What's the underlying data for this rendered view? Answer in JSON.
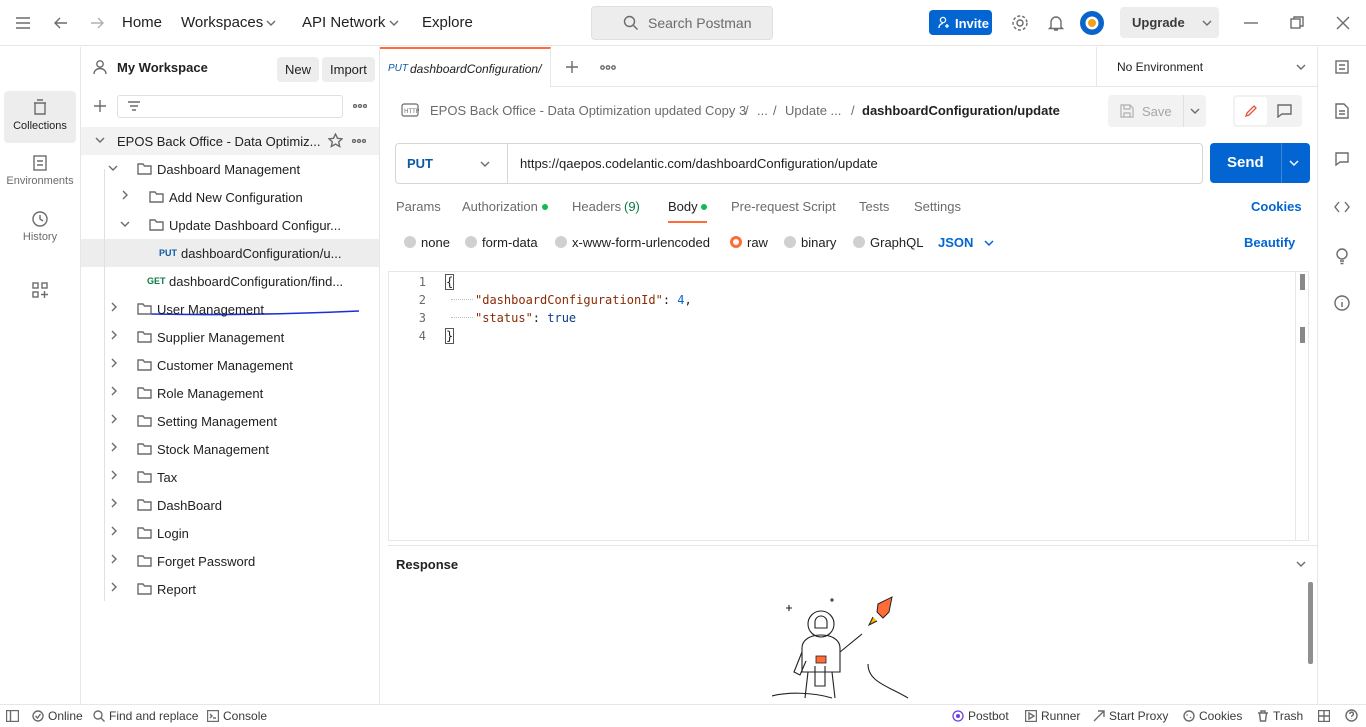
{
  "topbar": {
    "home": "Home",
    "workspaces": "Workspaces",
    "api_network": "API Network",
    "explore": "Explore",
    "search_placeholder": "Search Postman",
    "invite": "Invite",
    "upgrade": "Upgrade"
  },
  "rail": {
    "items": [
      {
        "label": "Collections",
        "icon": "collections-icon"
      },
      {
        "label": "Environments",
        "icon": "environments-icon"
      },
      {
        "label": "History",
        "icon": "history-icon"
      }
    ]
  },
  "sidebar": {
    "workspace": "My Workspace",
    "new_label": "New",
    "import_label": "Import",
    "collection": "EPOS Back Office - Data Optimiz...",
    "folders_top": {
      "dashboard_management": "Dashboard Management",
      "add_new_configuration": "Add New Configuration",
      "update_dashboard": "Update Dashboard Configur...",
      "req_put": {
        "method": "PUT",
        "name": "dashboardConfiguration/u..."
      },
      "req_get": {
        "method": "GET",
        "name": "dashboardConfiguration/find..."
      }
    },
    "folders": [
      "User Management",
      "Supplier Management",
      "Customer Management",
      "Role Management",
      "Setting Management",
      "Stock Management",
      "Tax",
      "DashBoard",
      "Login",
      "Forget Password",
      "Report"
    ]
  },
  "tabs": {
    "active_method": "PUT",
    "active_name": "dashboardConfiguration/",
    "environment": "No Environment"
  },
  "breadcrumb": {
    "collection": "EPOS Back Office - Data Optimization updated Copy 3",
    "sep": "/",
    "ellipsis": "...",
    "folder": "Update ...",
    "request": "dashboardConfiguration/update",
    "save": "Save"
  },
  "request": {
    "method": "PUT",
    "url": "https://qaepos.codelantic.com/dashboardConfiguration/update",
    "send": "Send"
  },
  "req_tabs": {
    "params": "Params",
    "authorization": "Authorization",
    "headers": "Headers",
    "headers_count": "(9)",
    "body": "Body",
    "pre_request": "Pre-request Script",
    "tests": "Tests",
    "settings": "Settings",
    "cookies": "Cookies"
  },
  "body_options": {
    "none": "none",
    "form_data": "form-data",
    "urlencoded": "x-www-form-urlencoded",
    "raw": "raw",
    "binary": "binary",
    "graphql": "GraphQL",
    "format": "JSON",
    "beautify": "Beautify"
  },
  "editor": {
    "line_numbers": [
      "1",
      "2",
      "3",
      "4"
    ],
    "open_brace": "{",
    "key1": "\"dashboardConfigurationId\"",
    "val1": "4",
    "key2": "\"status\"",
    "val2": "true",
    "close_brace": "}"
  },
  "response": {
    "label": "Response"
  },
  "statusbar": {
    "online": "Online",
    "find_replace": "Find and replace",
    "console": "Console",
    "postbot": "Postbot",
    "runner": "Runner",
    "start_proxy": "Start Proxy",
    "cookies": "Cookies",
    "trash": "Trash"
  },
  "colors": {
    "accent": "#0265d2",
    "put_method": "#0b5aa8",
    "get_method": "#0c7a43",
    "tab_underline": "#ff6c37",
    "status_dot": "#0cbb52"
  }
}
